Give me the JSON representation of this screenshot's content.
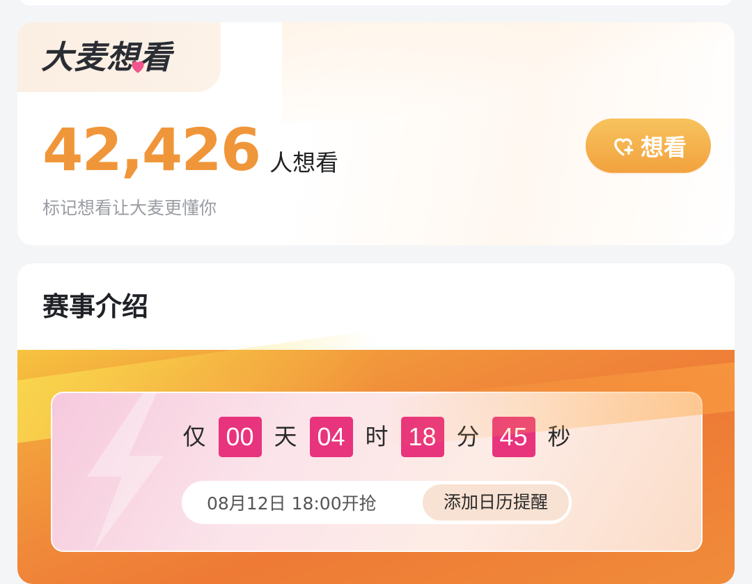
{
  "want_section": {
    "logo_text": "大麦想看",
    "count": "42,426",
    "count_suffix": "人想看",
    "hint": "标记想看让大麦更懂你",
    "want_button_label": "想看",
    "accent_color": "#f0963a"
  },
  "intro_section": {
    "title": "赛事介绍",
    "countdown": {
      "prefix": "仅",
      "days": "00",
      "days_unit": "天",
      "hours": "04",
      "hours_unit": "时",
      "minutes": "18",
      "minutes_unit": "分",
      "seconds": "45",
      "seconds_unit": "秒",
      "box_color": "#e8337d"
    },
    "sale_time": "08月12日 18:00开抢",
    "calendar_button_label": "添加日历提醒"
  },
  "icons": {
    "logo_heart": "heart-icon",
    "want_button": "heart-plus-icon"
  }
}
